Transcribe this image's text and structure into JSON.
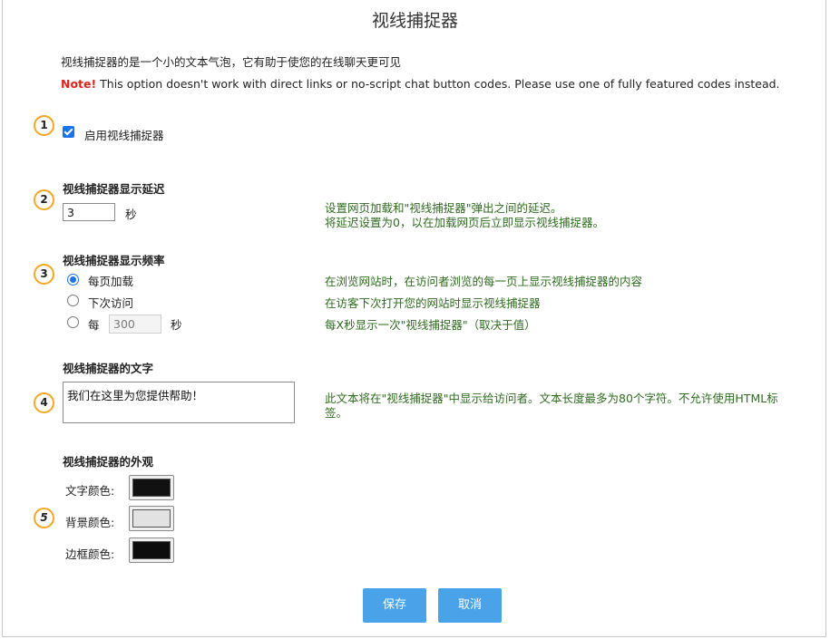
{
  "page": {
    "title": "视线捕捉器",
    "intro": "视线捕捉器的是一个小的文本气泡，它有助于使您的在线聊天更可见",
    "note_strong": "Note!",
    "note_text": " This option doesn't work with direct links or no-script chat button codes. Please use one of fully featured codes instead."
  },
  "steps": [
    "1",
    "2",
    "3",
    "4",
    "5"
  ],
  "enable": {
    "label": "启用视线捕捉器",
    "checked": true
  },
  "delay": {
    "heading": "视线捕捉器显示延迟",
    "value": "3",
    "unit": "秒",
    "hint_line1": "设置网页加载和\"视线捕捉器\"弹出之间的延迟。",
    "hint_line2": "将延迟设置为0，以在加载网页后立即显示视线捕捉器。"
  },
  "frequency": {
    "heading": "视线捕捉器显示频率",
    "options": [
      {
        "label": "每页加载",
        "hint": "在浏览网站时，在访问者浏览的每一页上显示视线捕捉器的内容",
        "selected": true
      },
      {
        "label": "下次访问",
        "hint": "在访客下次打开您的网站时显示视线捕捉器",
        "selected": false
      },
      {
        "label": "每",
        "value": "300",
        "unit": "秒",
        "hint": "每X秒显示一次\"视线捕捉器\"（取决于值）",
        "selected": false
      }
    ]
  },
  "text": {
    "heading": "视线捕捉器的文字",
    "value": "我们在这里为您提供帮助！",
    "hint_line1": "此文本将在\"视线捕捉器\"中显示给访问者。文本长度最多为80个字符。不允许使用HTML标",
    "hint_line2": "签。"
  },
  "appearance": {
    "heading": "视线捕捉器的外观",
    "colors": [
      {
        "label": "文字颜色:",
        "color": "#111111"
      },
      {
        "label": "背景颜色:",
        "color": "#e2e2e2"
      },
      {
        "label": "边框颜色:",
        "color": "#0d0d0d"
      }
    ]
  },
  "buttons": {
    "save": "保存",
    "cancel": "取消"
  },
  "theme": {
    "accent": "#4aa3e8",
    "step_ring": "#f5a623",
    "hint_color": "#2e6b1f",
    "note_color": "#e0231b"
  }
}
